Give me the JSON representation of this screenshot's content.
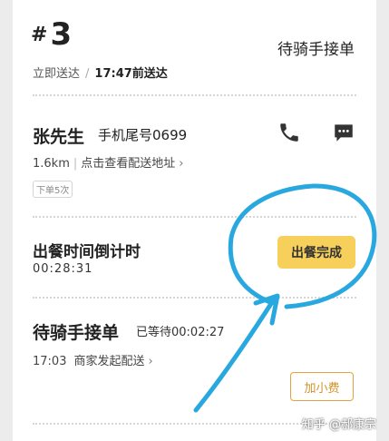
{
  "order": {
    "hash": "#",
    "number": "3",
    "status": "待骑手接单",
    "delivery_mode": "立即送达",
    "delivery_separator": "/",
    "delivery_time": "17:47前送达"
  },
  "customer": {
    "name": "张先生",
    "phone_tail": "手机尾号0699",
    "distance": "1.6km",
    "address_link": "点击查看配送地址",
    "order_count": "下单5次"
  },
  "meal": {
    "countdown_title": "出餐时间倒计时",
    "countdown_time": "00:28:31",
    "ready_button": "出餐完成"
  },
  "rider": {
    "waiting_title": "待骑手接单",
    "waiting_elapsed": "已等待00:02:27",
    "dispatch_time": "17:03",
    "dispatch_label": "商家发起配送",
    "tip_button": "加小费"
  },
  "watermark": "知乎 @郝康宗",
  "icons": {
    "phone": "phone-icon",
    "chat": "chat-icon",
    "chevron": "chevron-right-icon"
  },
  "colors": {
    "accent_yellow": "#f7d05b",
    "tip_orange": "#d3932a",
    "annotation_blue": "#29a8e0"
  }
}
